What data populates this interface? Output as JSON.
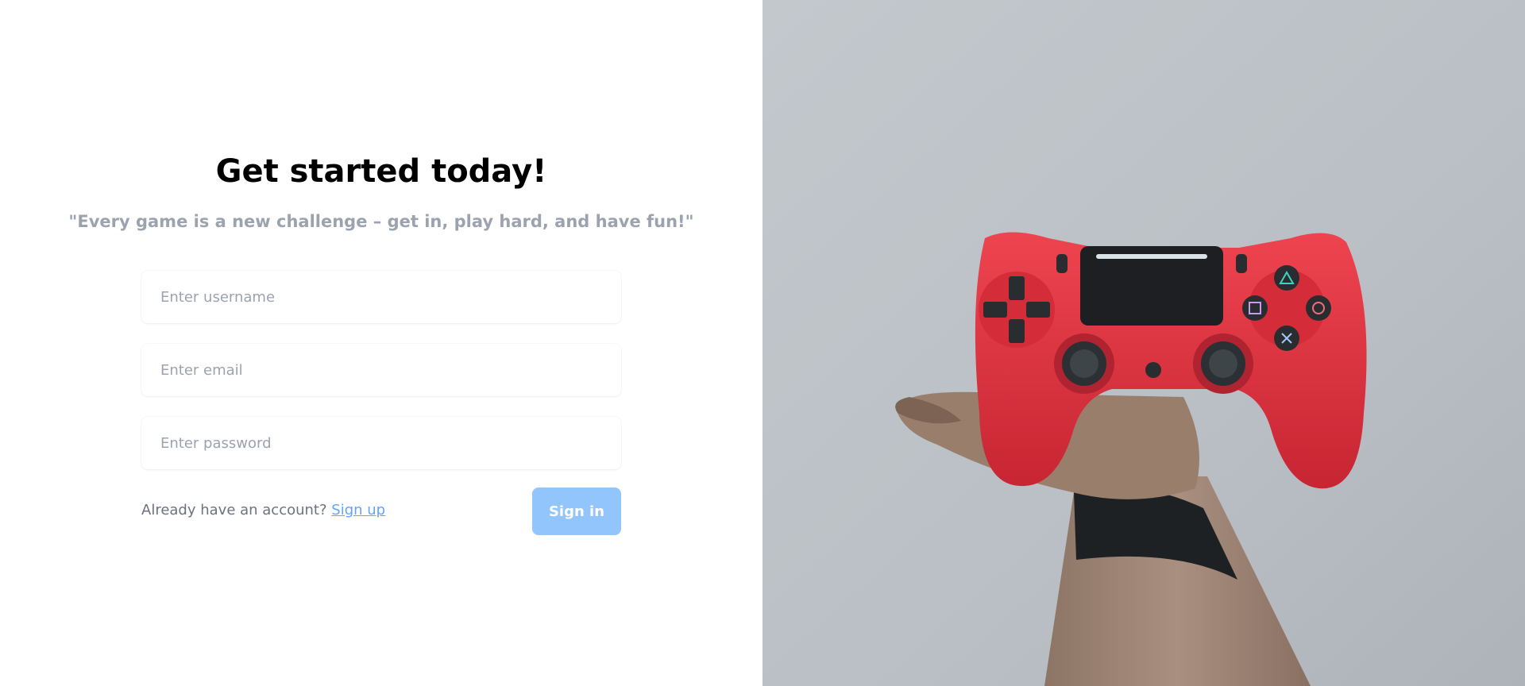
{
  "form": {
    "title": "Get started today!",
    "quote": "\"Every game is a new challenge – get in, play hard, and have fun!\"",
    "username_placeholder": "Enter username",
    "email_placeholder": "Enter email",
    "password_placeholder": "Enter password",
    "account_prompt": "Already have an account?",
    "signup_link": "Sign up",
    "signin_button": "Sign in"
  },
  "colors": {
    "title": "#000000",
    "quote": "#9ca3af",
    "link": "#60a5fa",
    "button": "#93c5fd",
    "controller": "#e0303c",
    "photo_background": "#b7bdc2"
  },
  "hero": {
    "image": "hand-holding-red-game-controller"
  }
}
